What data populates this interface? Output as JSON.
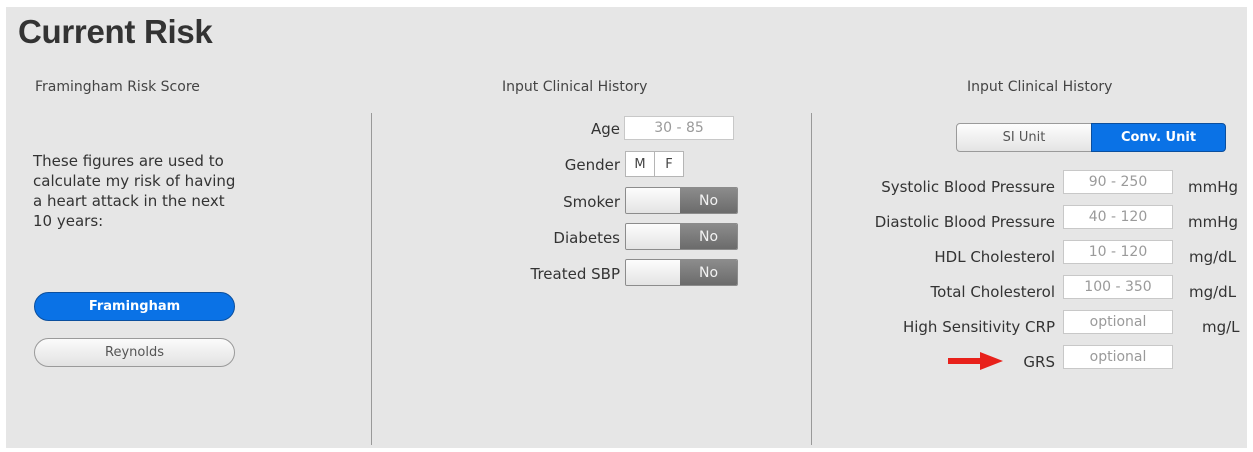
{
  "title": "Current Risk",
  "left": {
    "header": "Framingham Risk Score",
    "description": "These figures are used to calculate my risk of having a heart attack in the next 10 years:",
    "buttons": [
      {
        "label": "Framingham",
        "selected": true
      },
      {
        "label": "Reynolds",
        "selected": false
      }
    ]
  },
  "middle": {
    "header": "Input Clinical History",
    "age": {
      "label": "Age",
      "placeholder": "30 - 85"
    },
    "gender": {
      "label": "Gender",
      "options": [
        "M",
        "F"
      ]
    },
    "toggles": [
      {
        "label": "Smoker",
        "value": "No"
      },
      {
        "label": "Diabetes",
        "value": "No"
      },
      {
        "label": "Treated SBP",
        "value": "No"
      }
    ]
  },
  "right": {
    "header": "Input Clinical History",
    "unit_switch": {
      "si": "SI Unit",
      "conv": "Conv. Unit",
      "selected": "conv"
    },
    "fields": [
      {
        "label": "Systolic Blood Pressure",
        "placeholder": "90 - 250",
        "unit": "mmHg"
      },
      {
        "label": "Diastolic Blood Pressure",
        "placeholder": "40 - 120",
        "unit": "mmHg"
      },
      {
        "label": "HDL Cholesterol",
        "placeholder": "10 - 120",
        "unit": "mg/dL"
      },
      {
        "label": "Total Cholesterol",
        "placeholder": "100 - 350",
        "unit": "mg/dL"
      },
      {
        "label": "High Sensitivity CRP",
        "placeholder": "optional",
        "unit": "mg/L"
      },
      {
        "label": "GRS",
        "placeholder": "optional",
        "unit": ""
      }
    ],
    "annotation_arrow_color": "#e8211b"
  },
  "colors": {
    "accent": "#0a72e6",
    "panel": "#e6e6e6"
  }
}
